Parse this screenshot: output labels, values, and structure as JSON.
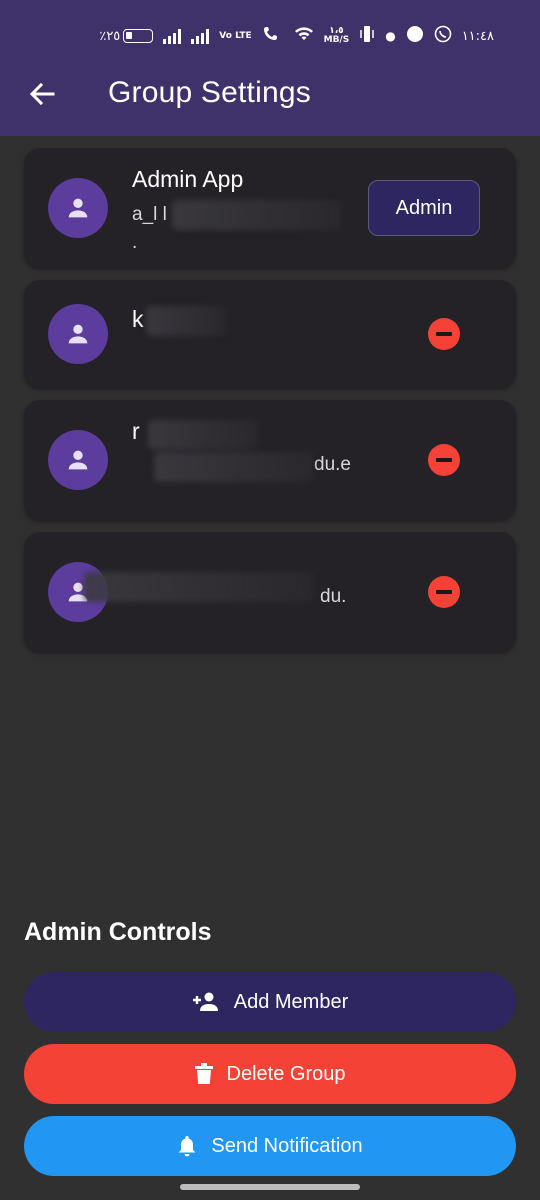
{
  "status_bar": {
    "battery_text": "٪٢٥",
    "network": "Vo LTE",
    "speed_value": "١،٥",
    "speed_unit": "MB/S",
    "time": "١١:٤٨"
  },
  "app_bar": {
    "title": "Group Settings"
  },
  "members": [
    {
      "name": "Admin App",
      "email": "a_l l",
      "sub": ".",
      "role": "Admin"
    },
    {
      "name": "k",
      "email": ""
    },
    {
      "name": "r",
      "email": "du.e"
    },
    {
      "name": "",
      "email": "du."
    }
  ],
  "admin_controls": {
    "title": "Admin Controls",
    "add_member": "Add Member",
    "delete_group": "Delete Group",
    "send_notification": "Send Notification"
  },
  "colors": {
    "app_bar": "#3f3169",
    "background": "#303030",
    "card": "#242226",
    "avatar": "#5c3c9c",
    "add_member": "#2e2660",
    "delete_group": "#f44336",
    "send_notification": "#2196f3"
  },
  "icons": {
    "back": "arrow-left-icon",
    "avatar": "person-icon",
    "remove": "minus-circle-icon",
    "add_member": "person-add-icon",
    "delete": "trash-icon",
    "notification": "bell-icon"
  }
}
